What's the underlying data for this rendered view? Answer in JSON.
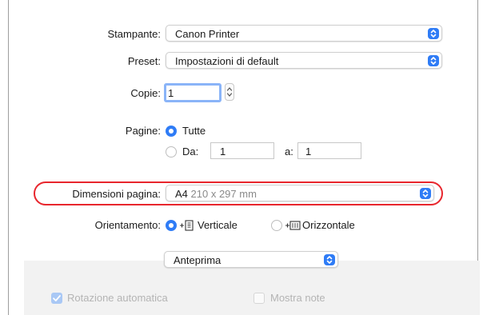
{
  "printer": {
    "label": "Stampante:",
    "value": "Canon Printer"
  },
  "preset": {
    "label": "Preset:",
    "value": "Impostazioni di default"
  },
  "copies": {
    "label": "Copie:",
    "value": "1"
  },
  "pages": {
    "label": "Pagine:",
    "all_label": "Tutte",
    "from_label": "Da:",
    "from_value": "1",
    "to_label": "a:",
    "to_value": "1"
  },
  "paper_size": {
    "label": "Dimensioni pagina:",
    "name": "A4",
    "size": "210 x 297 mm"
  },
  "orientation": {
    "label": "Orientamento:",
    "portrait_label": "Verticale",
    "landscape_label": "Orizzontale"
  },
  "section": {
    "value": "Anteprima"
  },
  "options": {
    "auto_rotate_label": "Rotazione automatica",
    "show_notes_label": "Mostra note"
  },
  "colors": {
    "accent": "#2f7cf6",
    "highlight_ring": "#e8262d"
  },
  "icons": {
    "popup_arrow": "updown-chevron-icon",
    "stepper": "stepper-icon",
    "portrait": "portrait-orientation-icon",
    "landscape": "landscape-orientation-icon"
  }
}
